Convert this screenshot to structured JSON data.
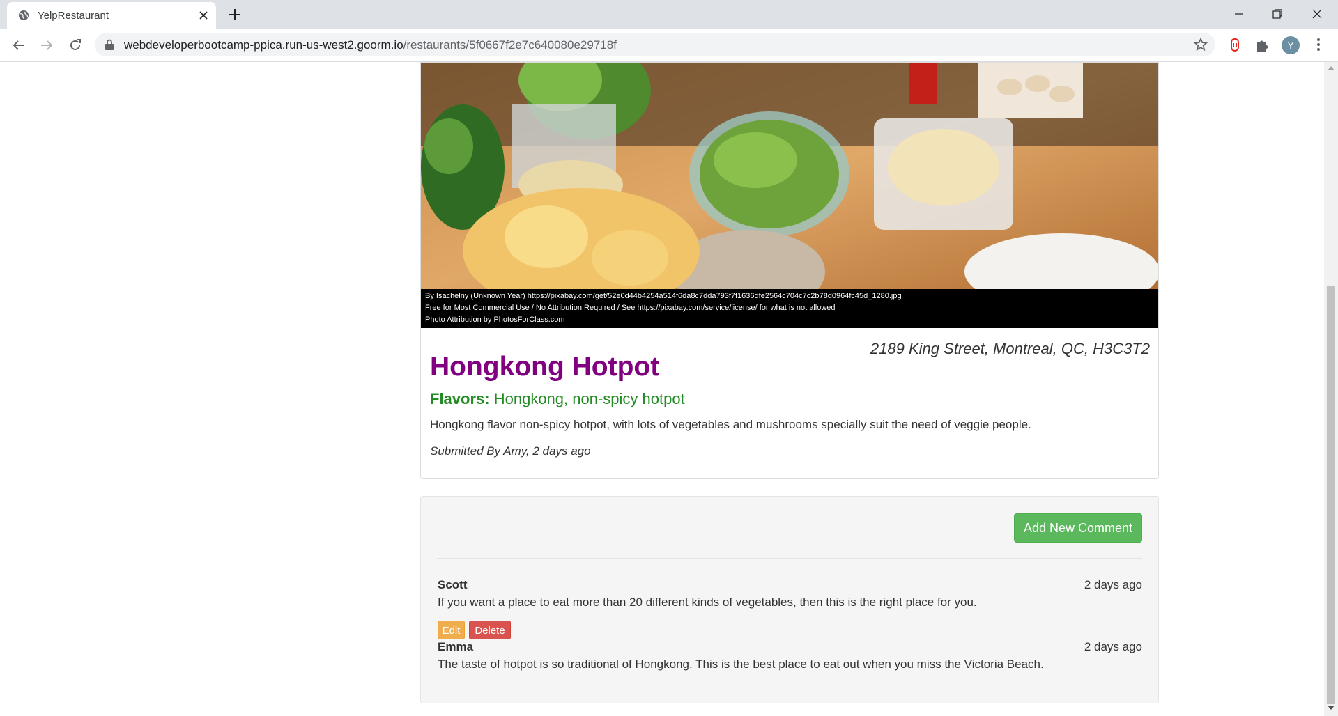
{
  "browser": {
    "tab_title": "YelpRestaurant",
    "url_host": "webdeveloperbootcamp-ppica.run-us-west2.goorm.io",
    "url_path": "/restaurants/5f0667f2e7c640080e29718f",
    "avatar_letter": "Y"
  },
  "restaurant": {
    "attribution": [
      "By  Isachelny  (Unknown  Year)  https://pixabay.com/get/52e0d44b4254a514f6da8c7dda793f7f1636dfe2564c704c7c2b78d0964fc45d_1280.jpg",
      "Free for Most Commercial Use / No Attribution Required / See https://pixabay.com/service/license/ for what is not allowed",
      "Photo Attribution by PhotosForClass.com"
    ],
    "address": "2189 King Street, Montreal, QC, H3C3T2",
    "name": "Hongkong Hotpot",
    "flavors_label": "Flavors:",
    "flavors_value": "Hongkong, non-spicy hotpot",
    "description": "Hongkong flavor non-spicy hotpot, with lots of vegetables and mushrooms specially suit the need of veggie people.",
    "submitted": "Submitted By Amy, 2 days ago"
  },
  "comments_section": {
    "add_button": "Add New Comment",
    "comments": [
      {
        "author": "Scott",
        "date": "2 days ago",
        "text": "If you want a place to eat more than 20 different kinds of vegetables, then this is the right place for you."
      },
      {
        "author": "Emma",
        "date": "2 days ago",
        "text": "The taste of hotpot is so traditional of Hongkong. This is the best place to eat out when you miss the Victoria Beach."
      }
    ],
    "edit_label": "Edit",
    "delete_label": "Delete"
  },
  "colors": {
    "name": "#800080",
    "flavors": "#228b22",
    "add_button": "#5cb85c",
    "edit_button": "#f0ad4e",
    "delete_button": "#d9534f"
  },
  "icons": [
    "globe-icon",
    "close-icon",
    "plus-icon",
    "minimize-icon",
    "restore-icon",
    "window-close-icon",
    "back-icon",
    "forward-icon",
    "reload-icon",
    "lock-icon",
    "star-icon",
    "extension-shield-icon",
    "puzzle-icon",
    "menu-dots-icon"
  ]
}
